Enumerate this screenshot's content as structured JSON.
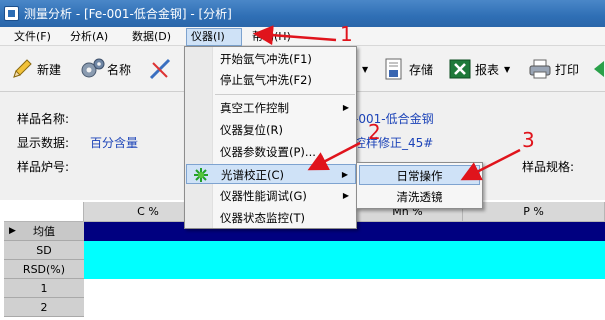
{
  "window": {
    "title": "测量分析 - [Fe-001-低合金钢] - [分析]"
  },
  "menubar": [
    {
      "label": "文件(F)"
    },
    {
      "label": "分析(A)"
    },
    {
      "label": "数据(D)"
    },
    {
      "label": "仪器(I)"
    },
    {
      "label": "帮助(H)"
    }
  ],
  "toolbar": {
    "new_label": "新建",
    "name_label": "名称",
    "save_label": "存储",
    "report_label": "报表",
    "print_label": "打印"
  },
  "info": {
    "sample_name_label": "样品名称:",
    "sample_name_value": "-001-低合金钢",
    "display_data_label": "显示数据:",
    "display_data_value": "百分含量",
    "correction_value": "控样修正_45#",
    "heat_no_label": "样品炉号:",
    "spec_label": "样品规格:"
  },
  "grid": {
    "columns": [
      "C %",
      "Mn %",
      "P %"
    ],
    "rows": [
      "均值",
      "SD",
      "RSD(%)",
      "1",
      "2"
    ],
    "current_row_marker": "▶"
  },
  "instrument_menu": {
    "items": [
      {
        "label": "开始氩气冲洗(F1)",
        "submenu": false
      },
      {
        "label": "停止氩气冲洗(F2)",
        "submenu": false
      },
      {
        "label": "真空工作控制",
        "submenu": true
      },
      {
        "label": "仪器复位(R)",
        "submenu": false
      },
      {
        "label": "仪器参数设置(P)...",
        "submenu": false
      },
      {
        "label": "光谱校正(C)",
        "submenu": true,
        "highlighted": true
      },
      {
        "label": "仪器性能调试(G)",
        "submenu": true
      },
      {
        "label": "仪器状态监控(T)",
        "submenu": false
      }
    ]
  },
  "calibration_submenu": {
    "items": [
      {
        "label": "日常操作",
        "highlighted": true
      },
      {
        "label": "清洗透镜"
      }
    ]
  },
  "annotations": {
    "step1": "1",
    "step2": "2",
    "step3": "3"
  },
  "colors": {
    "grid_band": "#00ffff",
    "grid_header_band": "#000080",
    "annotation": "#e0141c",
    "highlight": "#cfe2f7"
  }
}
